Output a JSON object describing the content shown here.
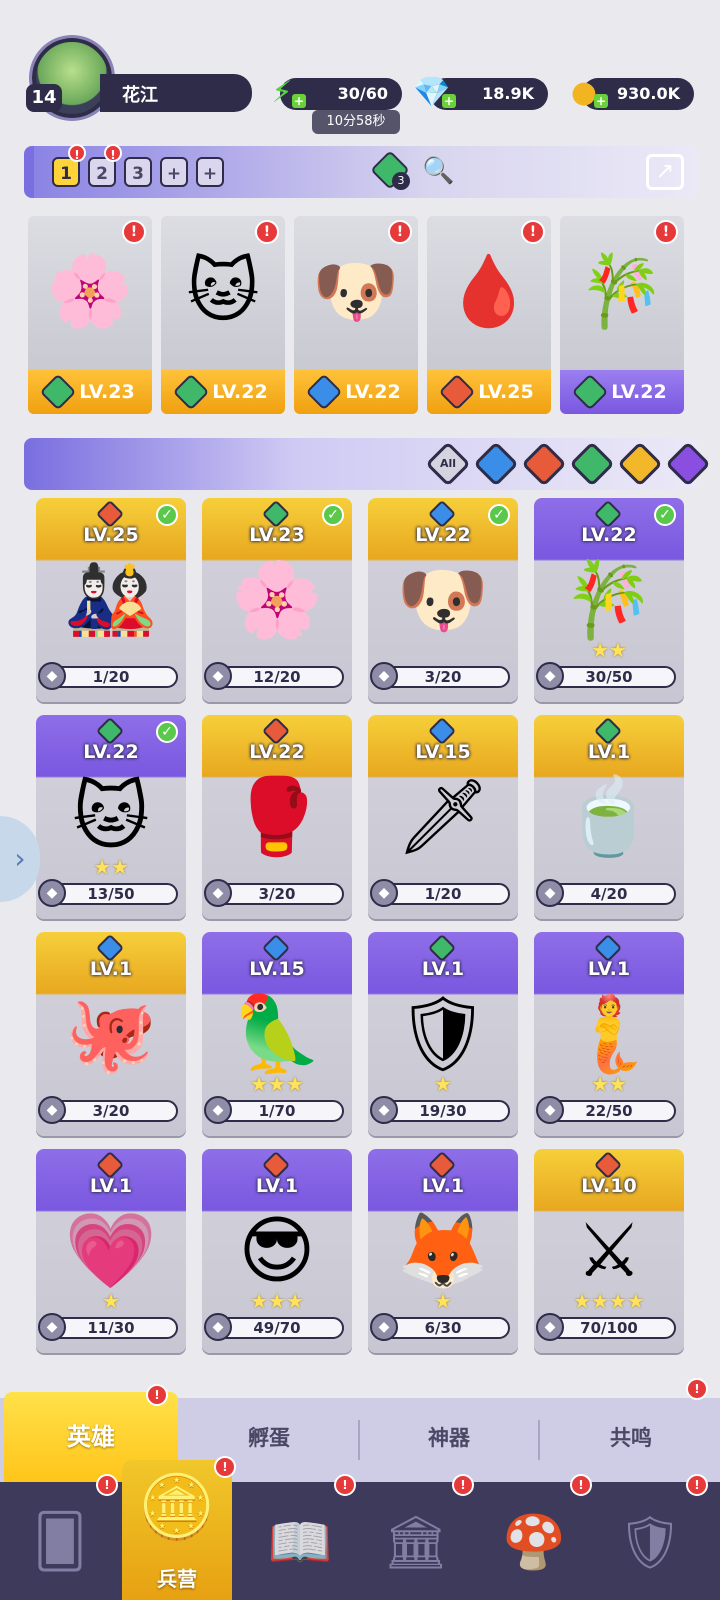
{
  "player": {
    "level": "14",
    "name": "花江"
  },
  "resources": {
    "energy": "30/60",
    "energy_timer": "10分58秒",
    "gems": "18.9K",
    "gold": "930.0K"
  },
  "team_bar": {
    "slots": [
      "1",
      "2",
      "3"
    ],
    "add_labels": [
      "+",
      "+"
    ],
    "active_slot": "1",
    "slot_badges": [
      "!",
      "!"
    ],
    "bonus_count": "3"
  },
  "team": [
    {
      "level": "LV.23",
      "element": "wind",
      "badge": "!",
      "footer": "gold",
      "icon": "🌸"
    },
    {
      "level": "LV.22",
      "element": "wind",
      "badge": "!",
      "footer": "gold",
      "icon": "🐱"
    },
    {
      "level": "LV.22",
      "element": "water",
      "badge": "!",
      "footer": "gold",
      "icon": "🐶"
    },
    {
      "level": "LV.25",
      "element": "fire",
      "badge": "!",
      "footer": "gold",
      "icon": "🩸"
    },
    {
      "level": "LV.22",
      "element": "wind",
      "badge": "!",
      "footer": "purple",
      "icon": "🎋"
    }
  ],
  "filters": [
    "All",
    "water",
    "fire",
    "wind",
    "light",
    "dark"
  ],
  "filter_all_label": "All",
  "colors": {
    "fire": "#e85b3a",
    "water": "#3a8ee8",
    "wind": "#3fb86a",
    "light": "#f3b82a",
    "dark": "#8a4ee0",
    "accent": "#7a6ee0",
    "badge": "#e6393a"
  },
  "heroes": [
    {
      "level": "LV.25",
      "element": "fire",
      "progress": "1/20",
      "stars": "",
      "check": true,
      "rarity": "gold",
      "icon": "🎎"
    },
    {
      "level": "LV.23",
      "element": "wind",
      "progress": "12/20",
      "stars": "",
      "check": true,
      "rarity": "gold",
      "icon": "🌸"
    },
    {
      "level": "LV.22",
      "element": "water",
      "progress": "3/20",
      "stars": "",
      "check": true,
      "rarity": "gold",
      "icon": "🐶"
    },
    {
      "level": "LV.22",
      "element": "wind",
      "progress": "30/50",
      "stars": "★★",
      "check": true,
      "rarity": "purple",
      "icon": "🎋"
    },
    {
      "level": "LV.22",
      "element": "wind",
      "progress": "13/50",
      "stars": "★★",
      "check": true,
      "rarity": "purple",
      "icon": "🐱"
    },
    {
      "level": "LV.22",
      "element": "fire",
      "progress": "3/20",
      "stars": "",
      "check": false,
      "rarity": "gold",
      "icon": "🥊"
    },
    {
      "level": "LV.15",
      "element": "water",
      "progress": "1/20",
      "stars": "",
      "check": false,
      "rarity": "gold",
      "icon": "🗡"
    },
    {
      "level": "LV.1",
      "element": "wind",
      "progress": "4/20",
      "stars": "",
      "check": false,
      "rarity": "gold",
      "icon": "🍵"
    },
    {
      "level": "LV.1",
      "element": "water",
      "progress": "3/20",
      "stars": "",
      "check": false,
      "rarity": "gold",
      "icon": "🐙"
    },
    {
      "level": "LV.15",
      "element": "water",
      "progress": "1/70",
      "stars": "★★★",
      "check": false,
      "rarity": "purple",
      "icon": "🦜"
    },
    {
      "level": "LV.1",
      "element": "wind",
      "progress": "19/30",
      "stars": "★",
      "check": false,
      "rarity": "purple",
      "icon": "🛡"
    },
    {
      "level": "LV.1",
      "element": "water",
      "progress": "22/50",
      "stars": "★★",
      "check": false,
      "rarity": "purple",
      "icon": "🧜"
    },
    {
      "level": "LV.1",
      "element": "fire",
      "progress": "11/30",
      "stars": "★",
      "check": false,
      "rarity": "purple",
      "icon": "💗"
    },
    {
      "level": "LV.1",
      "element": "fire",
      "progress": "49/70",
      "stars": "★★★",
      "check": false,
      "rarity": "purple",
      "icon": "😎"
    },
    {
      "level": "LV.1",
      "element": "fire",
      "progress": "6/30",
      "stars": "★",
      "check": false,
      "rarity": "purple",
      "icon": "🦊"
    },
    {
      "level": "LV.10",
      "element": "fire",
      "progress": "70/100",
      "stars": "★★★★",
      "check": false,
      "rarity": "gold",
      "icon": "⚔"
    }
  ],
  "subtabs": {
    "heroes": "英雄",
    "hatch": "孵蛋",
    "artifacts": "神器",
    "resonance": "共鸣"
  },
  "nav": {
    "active_label": "兵营"
  }
}
